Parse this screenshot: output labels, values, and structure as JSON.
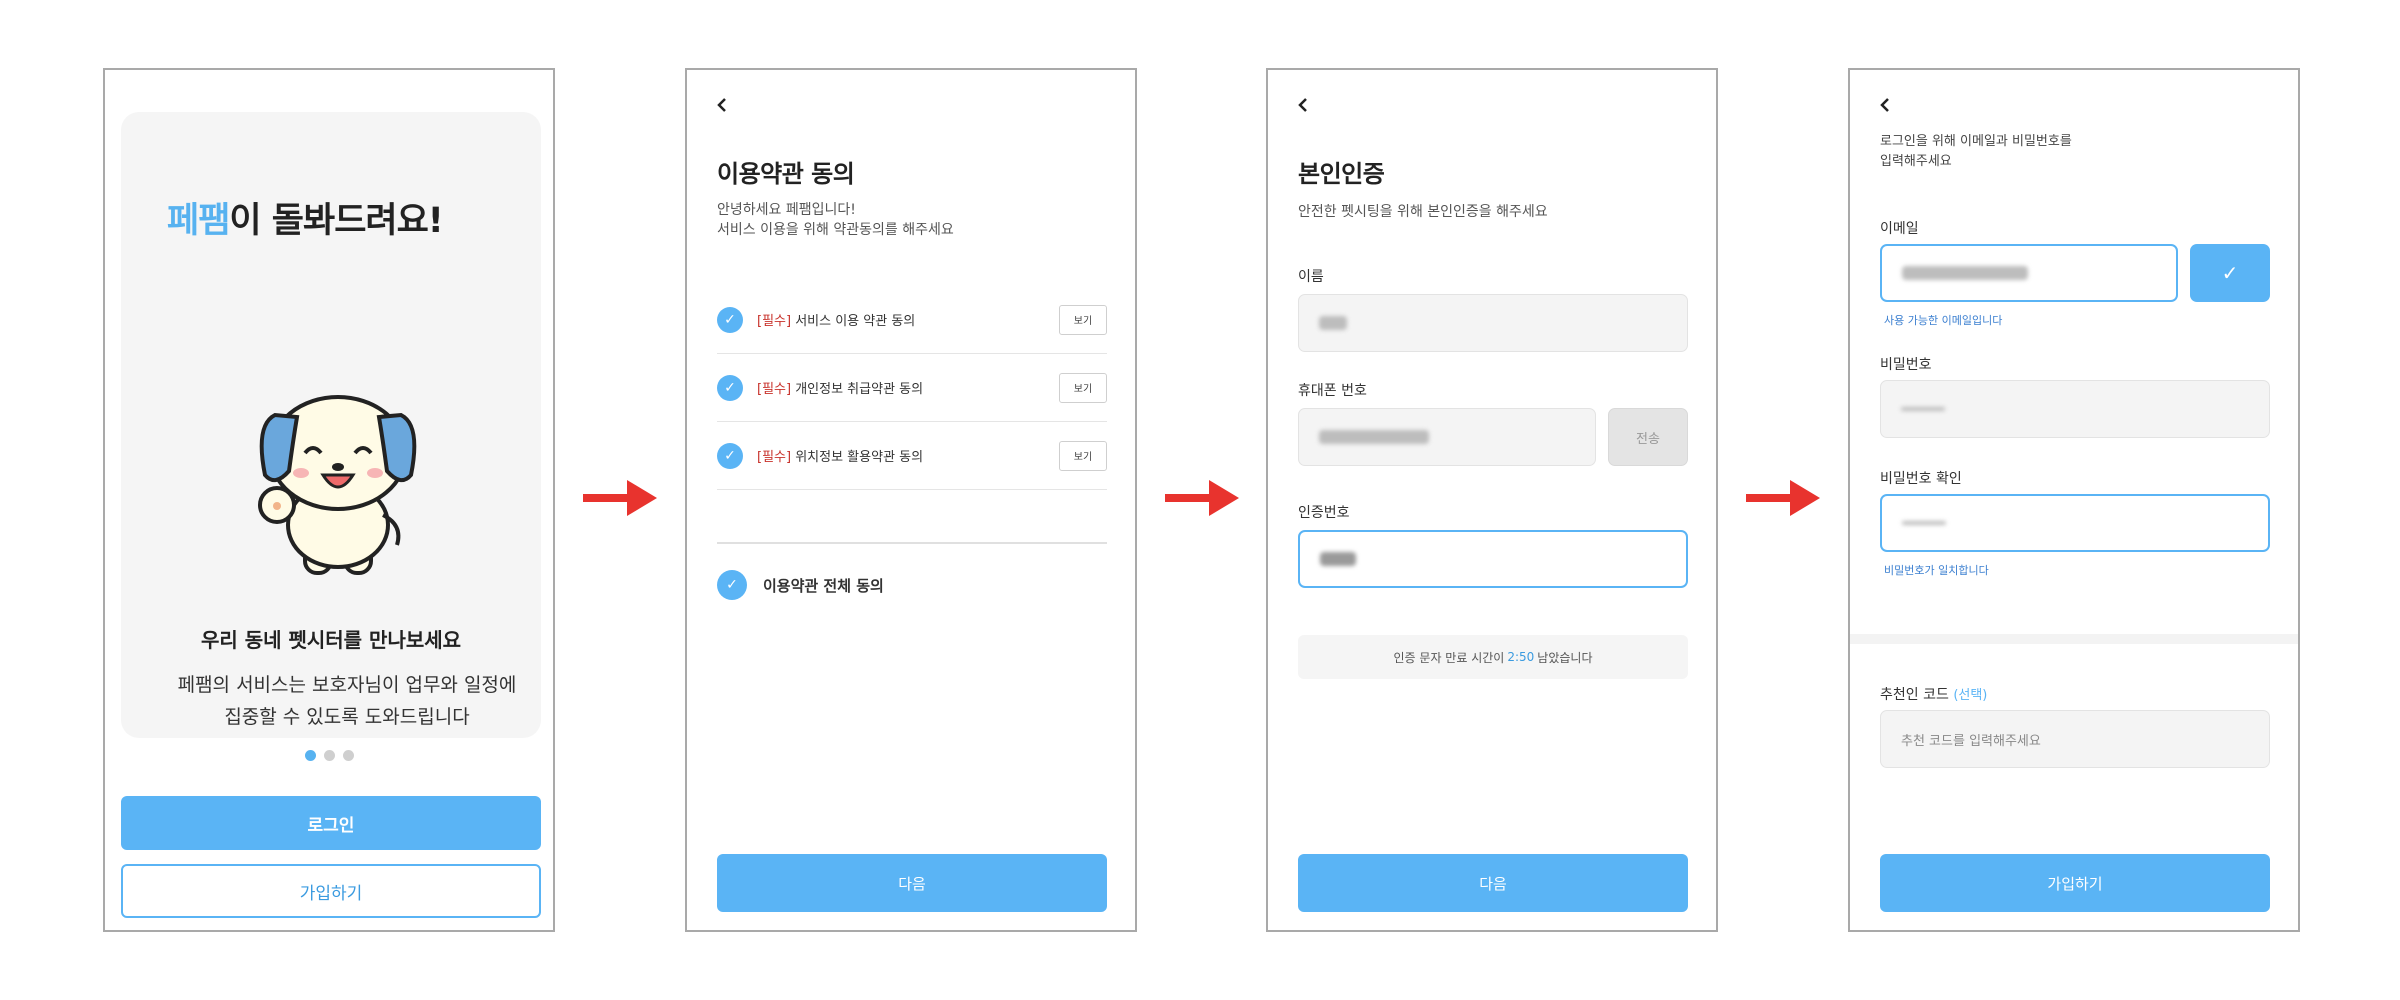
{
  "screen1": {
    "title_highlight": "페팸",
    "title_rest": "이 돌봐드려요!",
    "subtitle": "우리 동네 펫시터를 만나보세요",
    "desc_line1": "페팸의 서비스는 보호자님이 업무와 일정에",
    "desc_line2": "집중할 수 있도록 도와드립니다",
    "login_label": "로그인",
    "signup_label": "가입하기",
    "accent_color": "#57b2f0"
  },
  "screen2": {
    "title": "이용약관 동의",
    "desc_line1": "안녕하세요 페팸입니다!",
    "desc_line2": "서비스 이용을 위해 약관동의를 해주세요",
    "terms": [
      {
        "required_tag": "[필수]",
        "label": " 서비스 이용 약관 동의",
        "view": "보기",
        "checked": true
      },
      {
        "required_tag": "[필수]",
        "label": " 개인정보 취급약관 동의",
        "view": "보기",
        "checked": true
      },
      {
        "required_tag": "[필수]",
        "label": " 위치정보 활용약관 동의",
        "view": "보기",
        "checked": true
      }
    ],
    "agree_all_label": "이용약관 전체 동의",
    "next_label": "다음"
  },
  "screen3": {
    "title": "본인인증",
    "desc": "안전한 펫시팅을 위해 본인인증을 해주세요",
    "name_label": "이름",
    "phone_label": "휴대폰 번호",
    "send_label": "전송",
    "code_label": "인증번호",
    "timer_prefix": "인증 문자 만료 시간이",
    "timer_value": "2:50",
    "timer_suffix": "남았습니다",
    "next_label": "다음"
  },
  "screen4": {
    "intro_line1": "로그인을 위해 이메일과 비밀번호를",
    "intro_line2": "입력해주세요",
    "email_label": "이메일",
    "email_check": "✓",
    "email_helper": "사용 가능한 이메일입니다",
    "pw_label": "비밀번호",
    "pw_confirm_label": "비밀번호 확인",
    "pw_helper": "비밀번호가 일치합니다",
    "referral_label": "추천인 코드",
    "referral_optional": "(선택)",
    "referral_placeholder": "추천 코드를 입력해주세요",
    "signup_label": "가입하기"
  },
  "flow_arrow_color": "#e8332e"
}
